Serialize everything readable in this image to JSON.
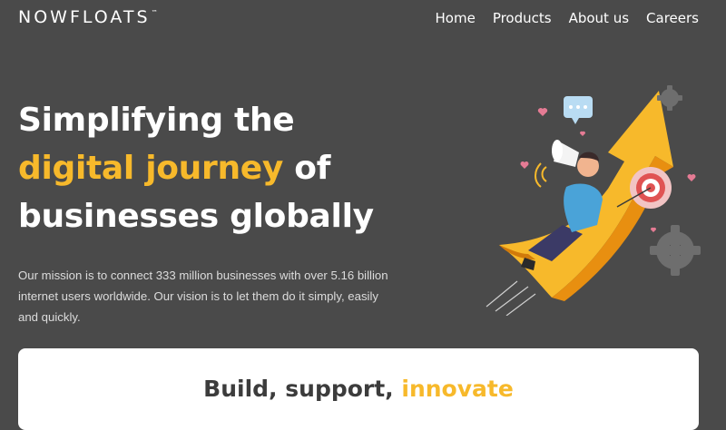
{
  "brand": {
    "logo_text": "NOWFLOATS",
    "trademark": "™"
  },
  "nav": {
    "items": [
      {
        "label": "Home"
      },
      {
        "label": "Products"
      },
      {
        "label": "About us"
      },
      {
        "label": "Careers"
      }
    ]
  },
  "hero": {
    "line1": "Simplifying the",
    "line2_highlight": "digital journey",
    "line2_rest": " of",
    "line3": "businesses globally",
    "mission": "Our mission is to connect 333 million businesses with over 5.16 billion internet users worldwide. Our vision is to let them do it simply, easily and quickly."
  },
  "section": {
    "title_plain": "Build, support, ",
    "title_highlight": "innovate"
  },
  "illustration": {
    "icons": [
      "rising-arrow-icon",
      "megaphone-icon",
      "target-icon",
      "gear-icon",
      "chat-bubble-icon",
      "heart-icon"
    ]
  },
  "colors": {
    "background": "#4a4a4a",
    "accent": "#f7b92b",
    "card": "#ffffff"
  }
}
